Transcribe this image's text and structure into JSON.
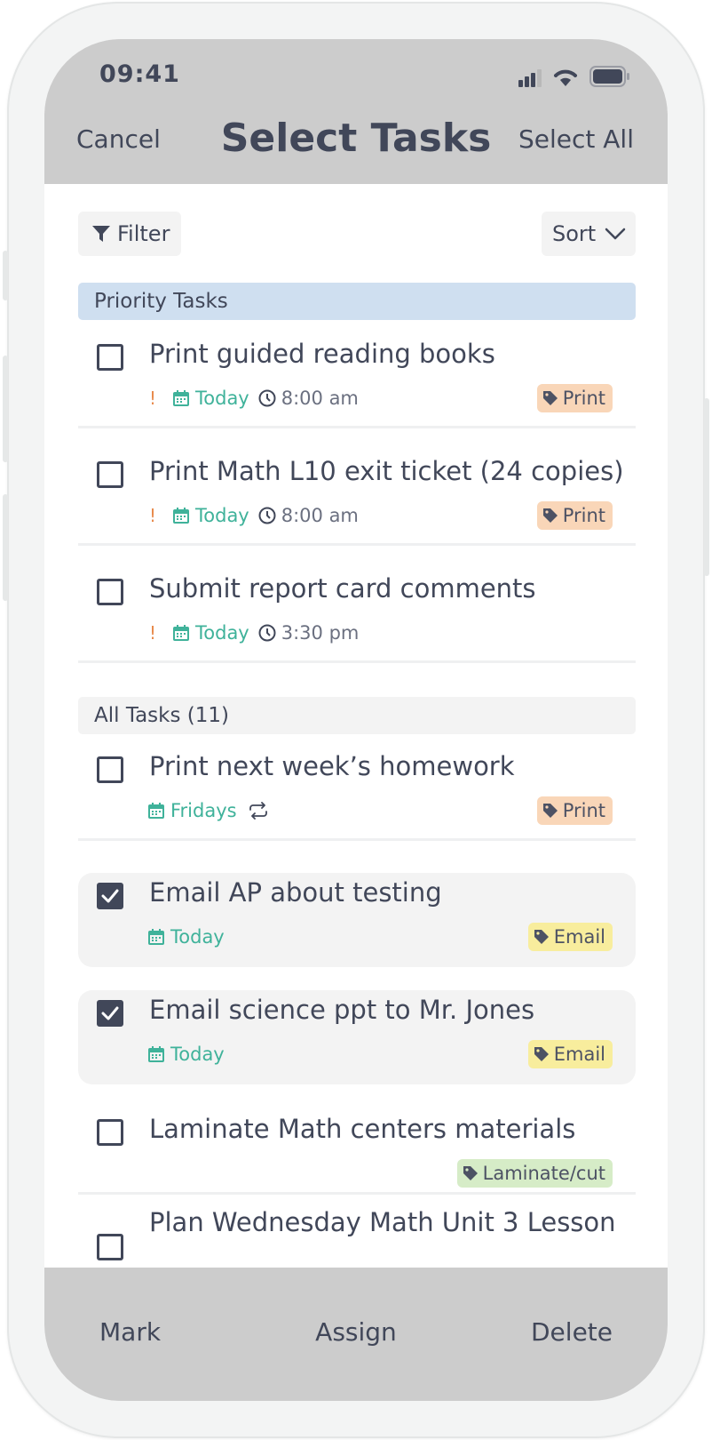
{
  "status": {
    "time": "09:41"
  },
  "nav": {
    "cancel": "Cancel",
    "title": "Select Tasks",
    "select_all": "Select All"
  },
  "toolbar": {
    "filter": "Filter",
    "sort": "Sort"
  },
  "sections": {
    "priority": "Priority Tasks",
    "all": "All Tasks (11)"
  },
  "tasks": [
    {
      "title": "Print guided reading books",
      "priority": "!",
      "date": "Today",
      "time": "8:00 am",
      "tag": "Print",
      "checked": false
    },
    {
      "title": "Print Math L10 exit ticket (24 copies)",
      "priority": "!",
      "date": "Today",
      "time": "8:00 am",
      "tag": "Print",
      "checked": false
    },
    {
      "title": "Submit report card comments",
      "priority": "!",
      "date": "Today",
      "time": "3:30 pm",
      "checked": false
    },
    {
      "title": "Print next week’s homework",
      "date": "Fridays",
      "repeat": true,
      "tag": "Print",
      "checked": false
    },
    {
      "title": "Email AP about testing",
      "date": "Today",
      "tag": "Email",
      "checked": true
    },
    {
      "title": "Email science ppt to Mr. Jones",
      "date": "Today",
      "tag": "Email",
      "checked": true
    },
    {
      "title": "Laminate Math centers materials",
      "tag": "Laminate/cut",
      "checked": false
    },
    {
      "title": "Plan Wednesday Math Unit 3 Lesson",
      "checked": false
    }
  ],
  "bottom": {
    "mark": "Mark",
    "assign": "Assign",
    "delete": "Delete"
  },
  "colors": {
    "bar": "#cccccc",
    "text": "#414759",
    "date_green": "#3fb29a",
    "priority_orange": "#e88a4c",
    "tag_print": "#f9d6b8",
    "tag_email": "#f8ed9d",
    "tag_laminate": "#d6ecc7",
    "priority_header": "#cfdff0"
  },
  "icons": [
    "signal-icon",
    "wifi-icon",
    "battery-icon",
    "filter-icon",
    "chevron-down-icon",
    "calendar-icon",
    "clock-icon",
    "repeat-icon",
    "tag-icon",
    "checkmark-icon"
  ]
}
